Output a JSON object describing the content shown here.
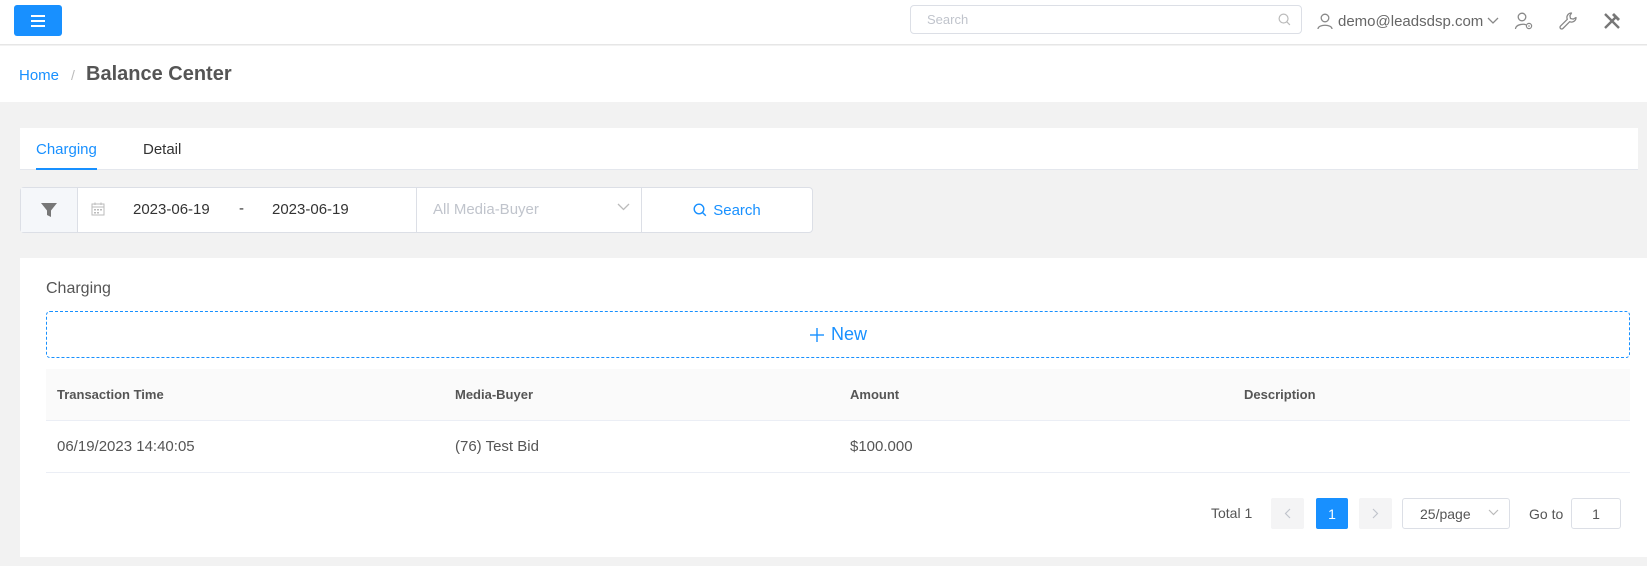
{
  "header": {
    "search_placeholder": "Search",
    "user_email": "demo@leadsdsp.com"
  },
  "breadcrumb": {
    "home": "Home",
    "separator": "/",
    "title": "Balance Center"
  },
  "tabs": [
    {
      "label": "Charging",
      "active": true
    },
    {
      "label": "Detail",
      "active": false
    }
  ],
  "filter": {
    "date_start": "2023-06-19",
    "date_separator": "-",
    "date_end": "2023-06-19",
    "media_buyer_placeholder": "All Media-Buyer",
    "search_label": "Search"
  },
  "card": {
    "title": "Charging",
    "new_label": "New"
  },
  "table": {
    "columns": [
      "Transaction Time",
      "Media-Buyer",
      "Amount",
      "Description"
    ],
    "rows": [
      [
        "06/19/2023 14:40:05",
        "(76) Test Bid",
        "$100.000",
        ""
      ]
    ]
  },
  "pagination": {
    "total_label": "Total 1",
    "current_page": "1",
    "page_size": "25/page",
    "goto_label": "Go to",
    "goto_value": "1"
  },
  "colors": {
    "primary": "#1890ff",
    "page_background": "#f2f2f2"
  }
}
